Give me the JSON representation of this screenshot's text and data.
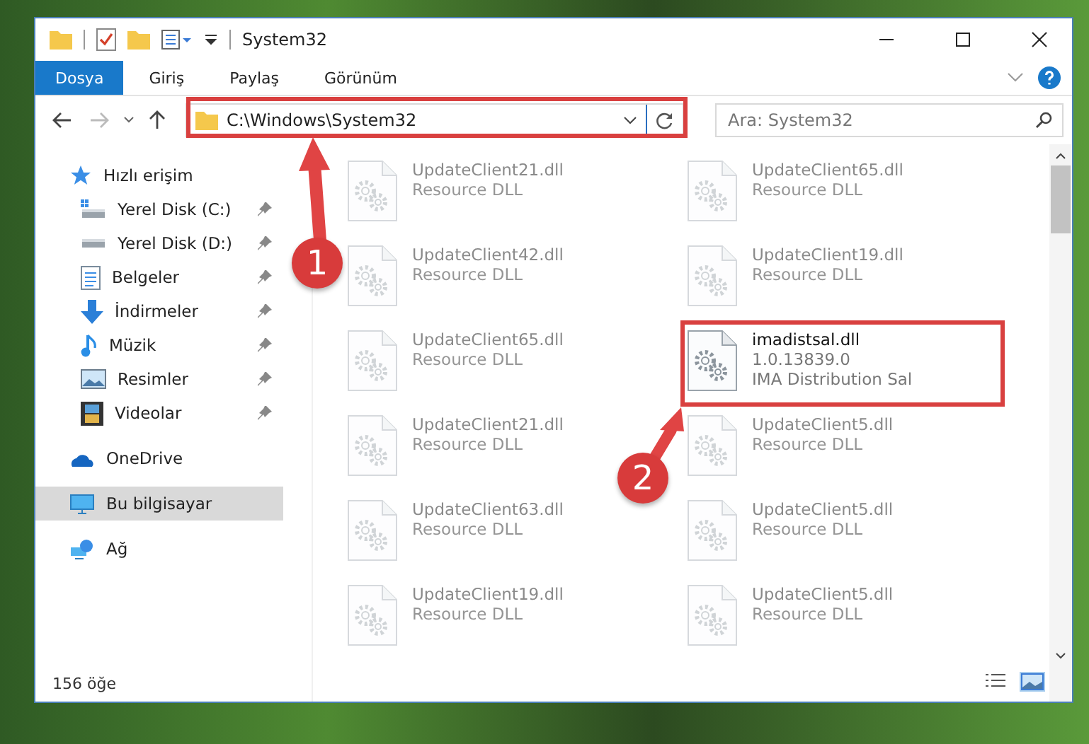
{
  "window": {
    "title": "System32"
  },
  "ribbon": {
    "tabs": [
      {
        "label": "Dosya",
        "selected": true
      },
      {
        "label": "Giriş",
        "selected": false
      },
      {
        "label": "Paylaş",
        "selected": false
      },
      {
        "label": "Görünüm",
        "selected": false
      }
    ]
  },
  "address": {
    "path": "C:\\Windows\\System32"
  },
  "search": {
    "placeholder": "Ara: System32"
  },
  "sidebar": {
    "items": [
      {
        "label": "Hızlı erişim",
        "selected": false,
        "children": [
          {
            "label": "Yerel Disk (C:)",
            "pinned": true,
            "selected": false
          },
          {
            "label": "Yerel Disk (D:)",
            "pinned": true,
            "selected": false
          },
          {
            "label": "Belgeler",
            "pinned": true,
            "selected": false
          },
          {
            "label": "İndirmeler",
            "pinned": true,
            "selected": false
          },
          {
            "label": "Müzik",
            "pinned": true,
            "selected": false
          },
          {
            "label": "Resimler",
            "pinned": true,
            "selected": false
          },
          {
            "label": "Videolar",
            "pinned": true,
            "selected": false
          }
        ]
      },
      {
        "label": "OneDrive",
        "selected": false
      },
      {
        "label": "Bu bilgisayar",
        "selected": true
      },
      {
        "label": "Ağ",
        "selected": false
      }
    ]
  },
  "files": [
    {
      "name": "UpdateClient21.dll",
      "type": "Resource DLL",
      "kind": "blurred"
    },
    {
      "name": "UpdateClient65.dll",
      "type": "Resource DLL",
      "kind": "blurred"
    },
    {
      "name": "UpdateClient42.dll",
      "type": "Resource DLL",
      "kind": "blurred"
    },
    {
      "name": "UpdateClient19.dll",
      "type": "Resource DLL",
      "kind": "blurred"
    },
    {
      "name": "UpdateClient65.dll",
      "type": "Resource DLL",
      "kind": "blurred"
    },
    {
      "name": "imadistsal.dll",
      "version": "1.0.13839.0",
      "description": "IMA Distribution Sal",
      "kind": "focus"
    },
    {
      "name": "UpdateClient21.dll",
      "type": "Resource DLL",
      "kind": "blurred"
    },
    {
      "name": "UpdateClient5.dll",
      "type": "Resource DLL",
      "kind": "blurred"
    },
    {
      "name": "UpdateClient63.dll",
      "type": "Resource DLL",
      "kind": "blurred"
    },
    {
      "name": "UpdateClient5.dll",
      "type": "Resource DLL",
      "kind": "blurred"
    },
    {
      "name": "UpdateClient19.dll",
      "type": "Resource DLL",
      "kind": "blurred"
    },
    {
      "name": "UpdateClient5.dll",
      "type": "Resource DLL",
      "kind": "blurred"
    }
  ],
  "status_bar": {
    "count": "156 öğe"
  },
  "annotations": [
    {
      "number": "1"
    },
    {
      "number": "2"
    }
  ]
}
